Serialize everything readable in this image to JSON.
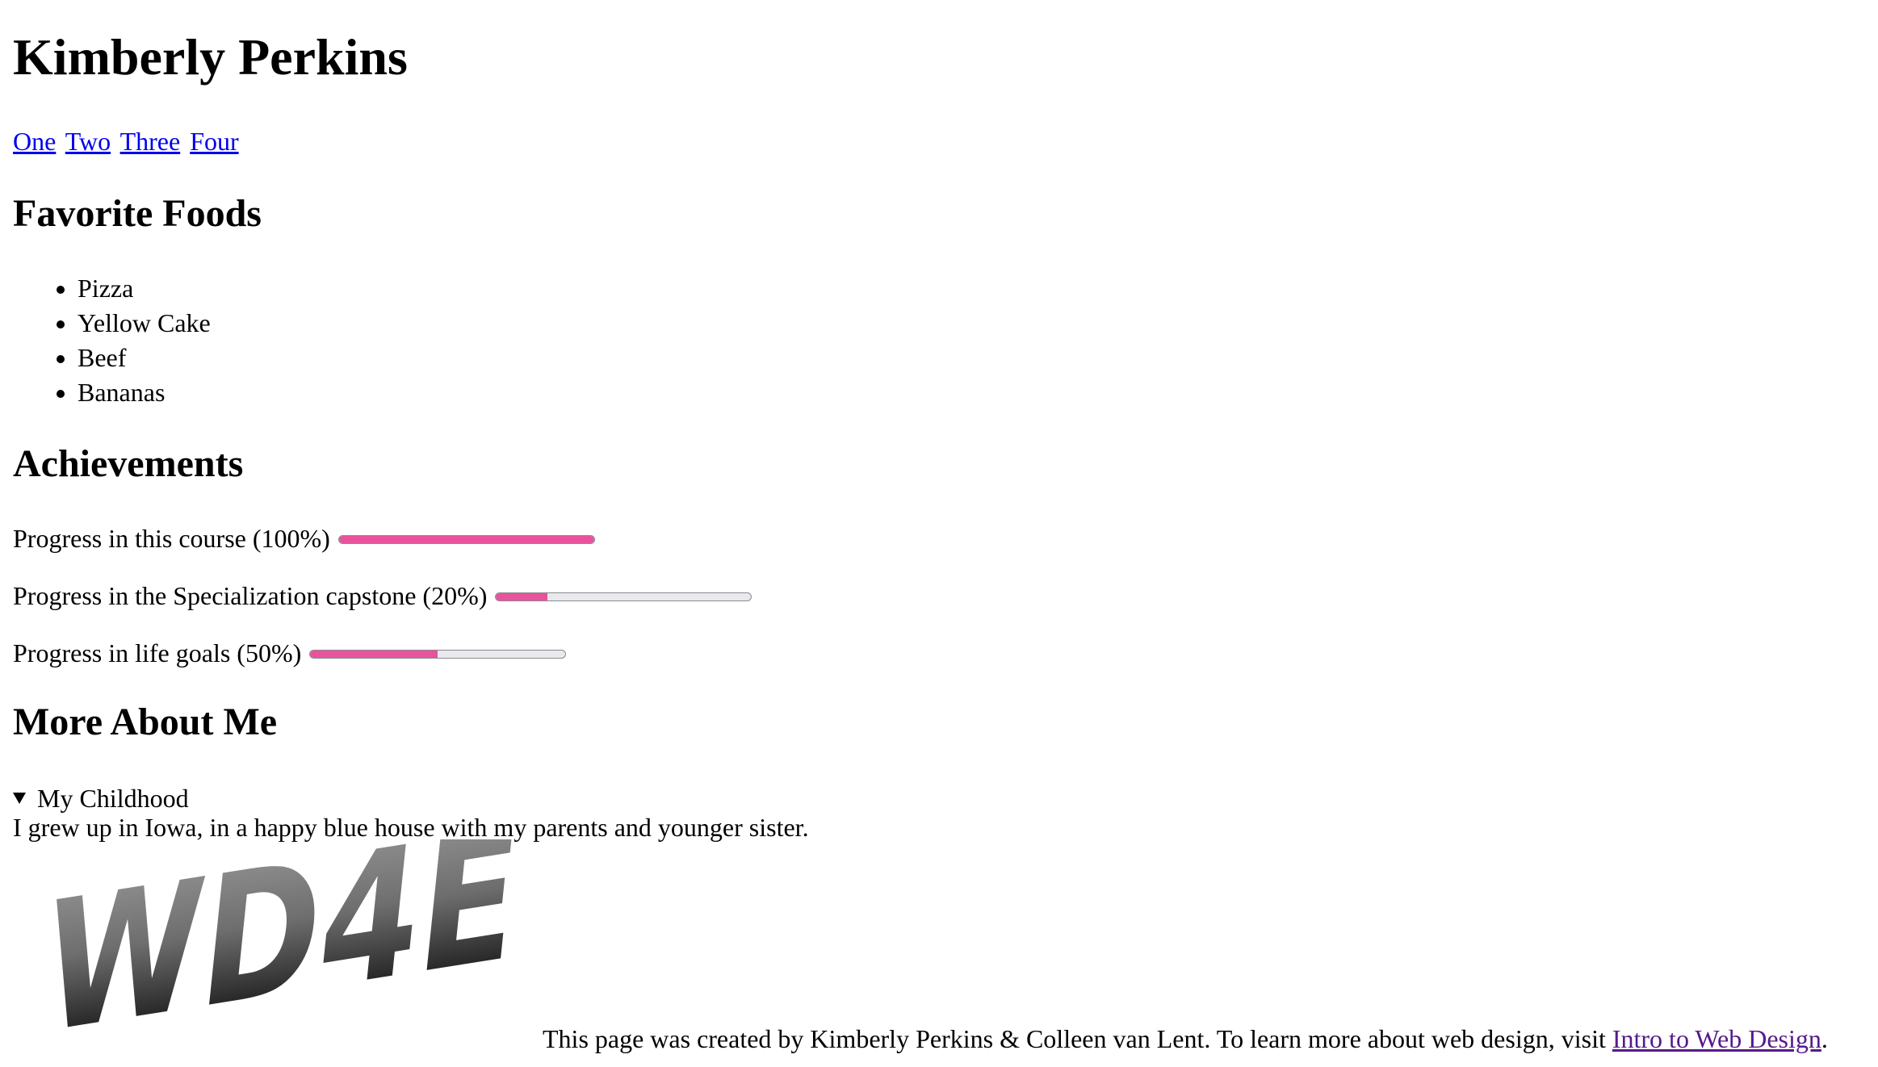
{
  "header": {
    "title": "Kimberly Perkins"
  },
  "nav": {
    "links": [
      "One",
      "Two",
      "Three",
      "Four"
    ]
  },
  "foods": {
    "heading": "Favorite Foods",
    "items": [
      "Pizza",
      "Yellow Cake",
      "Beef",
      "Bananas"
    ]
  },
  "achievements": {
    "heading": "Achievements",
    "items": [
      {
        "label": "Progress in this course (100%)",
        "value": 100
      },
      {
        "label": "Progress in the Specialization capstone (20%)",
        "value": 20
      },
      {
        "label": "Progress in life goals (50%)",
        "value": 50
      }
    ],
    "bar_color": "#e8539c",
    "track_color": "#e9e9ed"
  },
  "about": {
    "heading": "More About Me",
    "summary": "My Childhood",
    "text": "I grew up in Iowa, in a happy blue house with my parents and younger sister."
  },
  "logo": {
    "text": "WD4E"
  },
  "footer": {
    "text": "This page was created by Kimberly Perkins & Colleen van Lent. To learn more about web design, visit ",
    "link_text": "Intro to Web Design",
    "end": "."
  },
  "colors": {
    "link": "#0000ee",
    "visited_link": "#551a8b"
  }
}
